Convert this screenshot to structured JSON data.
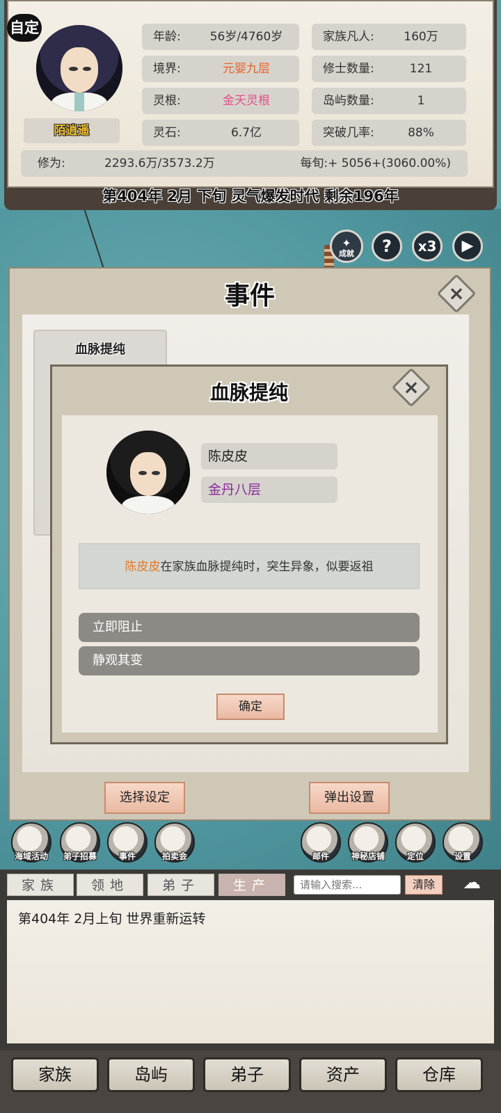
{
  "header": {
    "auto_badge": "自定",
    "player_name": "陌逍遥",
    "stats": [
      {
        "label": "年龄:",
        "value": "56岁/4760岁"
      },
      {
        "label": "境界:",
        "value": "元婴九层"
      },
      {
        "label": "灵根:",
        "value": "金天灵根"
      },
      {
        "label": "灵石:",
        "value": "6.7亿"
      },
      {
        "label": "家族凡人:",
        "value": "160万"
      },
      {
        "label": "修士数量:",
        "value": "121"
      },
      {
        "label": "岛屿数量:",
        "value": "1"
      },
      {
        "label": "突破几率:",
        "value": "88%"
      }
    ],
    "cultivation": {
      "label": "修为:",
      "value": "2293.6万/3573.2万",
      "rate": "每旬:+ 5056+(3060.00%)"
    },
    "date_line": "第404年 2月 下旬  灵气爆发时代 剩余196年"
  },
  "top_buttons": {
    "achievement_label": "成就",
    "help": "?",
    "speed": "x3",
    "play": "▶"
  },
  "event_window": {
    "title": "事件",
    "close": "×",
    "tab_title": "血脉提纯",
    "select_settings": "选择设定",
    "popup_settings": "弹出设置"
  },
  "dialog": {
    "title": "血脉提纯",
    "close": "×",
    "character_name": "陈皮皮",
    "character_realm": "金丹八层",
    "description_name": "陈皮皮",
    "description_text": "在家族血脉提纯时，突生异象，似要返祖",
    "choices": [
      "立即阻止",
      "静观其变"
    ],
    "confirm": "确定"
  },
  "actions": {
    "left": [
      {
        "label": "海域活动",
        "icon": "waves-icon"
      },
      {
        "label": "弟子招募",
        "icon": "disciple-icon"
      },
      {
        "label": "事件",
        "icon": "scroll-icon"
      },
      {
        "label": "拍卖会",
        "icon": "gavel-icon"
      }
    ],
    "right": [
      {
        "label": "邮件",
        "icon": "mail-icon"
      },
      {
        "label": "神秘店铺",
        "icon": "shop-icon"
      },
      {
        "label": "定位",
        "icon": "flag-icon"
      },
      {
        "label": "设置",
        "icon": "gear-icon"
      }
    ]
  },
  "log": {
    "tabs": [
      "家族",
      "领地",
      "弟子",
      "生产"
    ],
    "active_tab": 3,
    "search_placeholder": "请输入搜索...",
    "clear": "清除",
    "entries": [
      "第404年   2月上旬 世界重新运转"
    ]
  },
  "bottom_nav": [
    "家族",
    "岛屿",
    "弟子",
    "资产",
    "仓库"
  ],
  "colors": {
    "accent_orange": "#e8632a",
    "root_pink": "#e0508a",
    "realm_purple": "#8a2a9a",
    "name_gold": "#f0c030"
  }
}
